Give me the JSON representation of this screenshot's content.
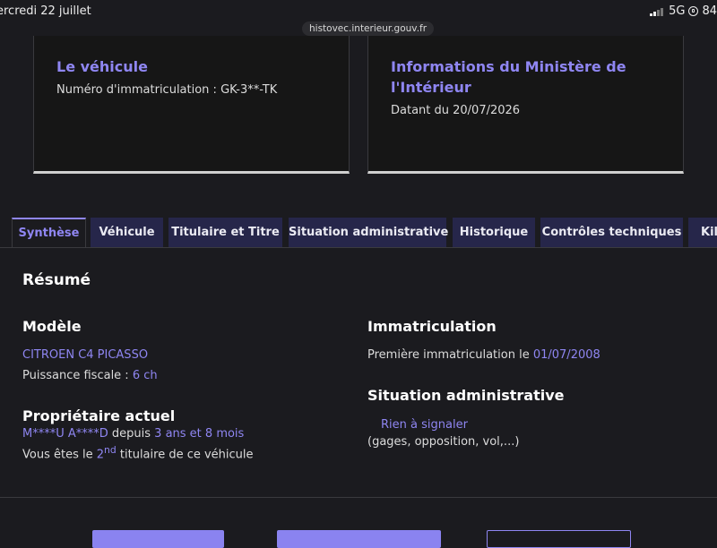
{
  "status_bar": {
    "date": "ercredi 22 juillet",
    "network": "5G",
    "battery": "84"
  },
  "url": "histovec.interieur.gouv.fr",
  "card_vehicle": {
    "title": "Le véhicule",
    "plate_label": "Numéro d'immatriculation : GK-3**-TK"
  },
  "card_ministry": {
    "title_line1": "Informations du Ministère de",
    "title_line2": "l'Intérieur",
    "date_label": "Datant du 20/07/2026"
  },
  "tabs": [
    {
      "label": "Synthèse",
      "active": true
    },
    {
      "label": "Véhicule",
      "active": false
    },
    {
      "label": "Titulaire et Titre",
      "active": false
    },
    {
      "label": "Situation administrative",
      "active": false
    },
    {
      "label": "Historique",
      "active": false
    },
    {
      "label": "Contrôles techniques",
      "active": false
    },
    {
      "label": "Kilo",
      "active": false
    }
  ],
  "summary": {
    "title": "Résumé",
    "model": {
      "heading": "Modèle",
      "name": "CITROEN C4 PICASSO",
      "power_prefix": "Puissance fiscale : ",
      "power_value": "6 ch"
    },
    "owner": {
      "heading": "Propriétaire actuel",
      "name": "M****U A****D",
      "since_word": " depuis ",
      "duration": "3 ans et 8 mois",
      "rank_prefix": "Vous êtes le ",
      "rank_number": "2",
      "rank_suffix": "nd",
      "rank_rest": " titulaire de ce véhicule"
    },
    "registration": {
      "heading": "Immatriculation",
      "first_prefix": "Première immatriculation le ",
      "first_date": "01/07/2008"
    },
    "admin": {
      "heading": "Situation administrative",
      "status": "Rien à signaler",
      "detail": "(gages, opposition, vol,...)"
    }
  },
  "colors": {
    "accent": "#8f86f2",
    "background": "#1b1b1f",
    "tab_background": "#26264a"
  }
}
